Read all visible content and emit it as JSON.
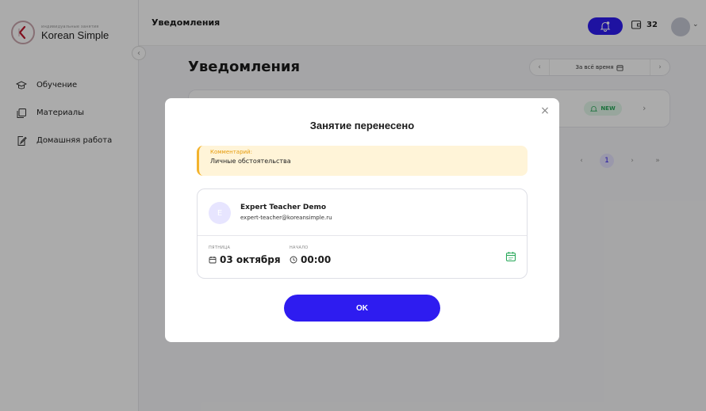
{
  "brand": {
    "subtitle": "индивидуальные занятия",
    "title": "Korean Simple",
    "accent": "#c9a6ad"
  },
  "sidebar": {
    "items": [
      {
        "label": "Обучение",
        "icon": "graduation-cap-icon"
      },
      {
        "label": "Материалы",
        "icon": "copy-icon"
      },
      {
        "label": "Домашняя работа",
        "icon": "edit-document-icon"
      }
    ]
  },
  "header": {
    "title": "Уведомления",
    "bell_icon": "bell-icon",
    "wallet_icon": "wallet-icon",
    "balance": "32",
    "accent": "#2e1cf0"
  },
  "main": {
    "page_title": "Уведомления",
    "filter": {
      "label": "За всё время",
      "prev": "‹",
      "next": "›"
    },
    "row": {
      "badge": "NEW",
      "arrow": "›"
    },
    "pagination": {
      "prev": "‹",
      "current": "1",
      "next": "›",
      "last": "»"
    }
  },
  "modal": {
    "close": "×",
    "title": "Занятие перенесено",
    "comment_label": "Комментарий:",
    "comment_text": "Личные обстоятельства",
    "teacher": {
      "initial": "E",
      "name": "Expert Teacher Demo",
      "email": "expert-teacher@koreansimple.ru"
    },
    "day_label": "ПЯТНИЦА",
    "date": "03 октября",
    "start_label": "НАЧАЛО",
    "time": "00:00",
    "ok_label": "OK",
    "colors": {
      "comment_bg": "#fff4d8",
      "comment_accent": "#f3b32d",
      "button": "#2e1cf0",
      "calendar_green": "#2aa95b"
    }
  }
}
